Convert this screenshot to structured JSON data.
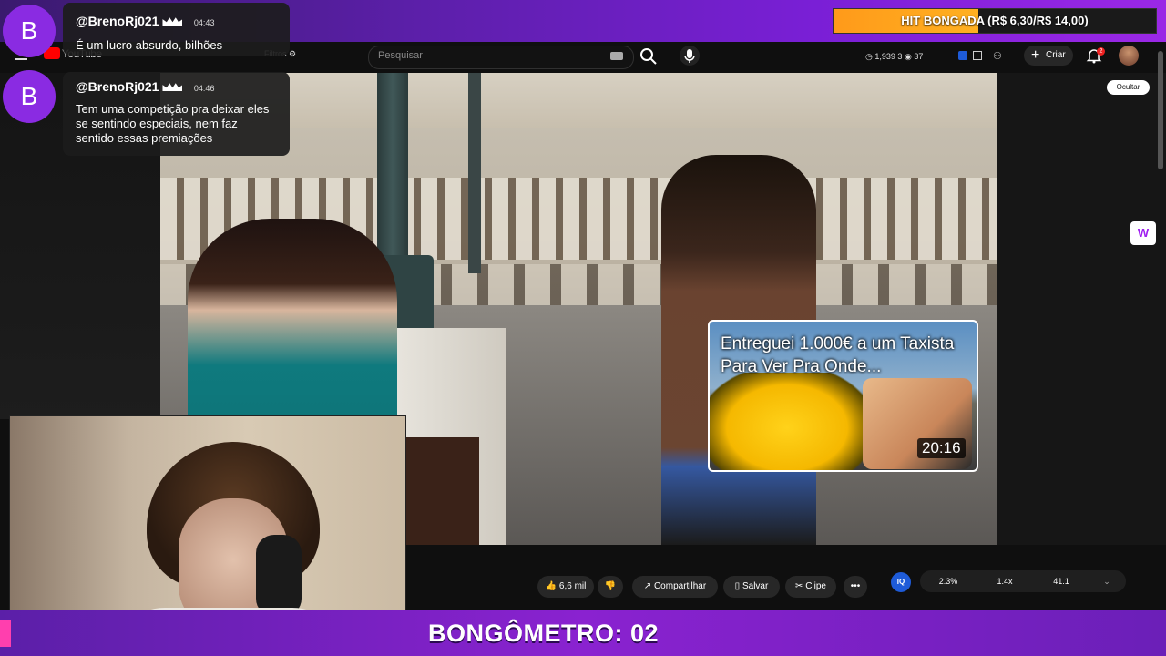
{
  "overlay": {
    "hit_label": "HIT BONGADA (R$ 6,30/R$ 14,00)",
    "hit_progress": 0.45,
    "counter_label": "BONGÔMETRO: 02"
  },
  "youtube": {
    "logo_text": "YouTube",
    "filters_label": "Filtros",
    "search_placeholder": "Pesquisar",
    "stats": {
      "views": "1,939",
      "count_a": "3",
      "count_b": "37"
    },
    "create_label": "Criar",
    "notifications_count": "2"
  },
  "video": {
    "hide_label": "Ocultar",
    "suggestion": {
      "title": "Entreguei 1.000€ a um Taxista Para Ver Pra Onde...",
      "duration": "20:16"
    }
  },
  "actions": {
    "likes": "6,6 mil",
    "share_label": "Compartilhar",
    "save_label": "Salvar",
    "clip_label": "Clipe",
    "metrics": [
      "2.3%",
      "1.4x",
      "41.1"
    ]
  },
  "chat": [
    {
      "avatar": "B",
      "user": "@BrenoRj021",
      "time": "04:43",
      "text": "É um lucro absurdo, bilhões"
    },
    {
      "avatar": "B",
      "user": "@BrenoRj021",
      "time": "04:46",
      "text": "Tem uma competição pra deixar eles se sentindo especiais, nem faz sentido essas premiações"
    }
  ],
  "colors": {
    "accent_purple": "#8a2be2",
    "hit_orange": "#ffa31a",
    "yt_red": "#ff0000"
  }
}
